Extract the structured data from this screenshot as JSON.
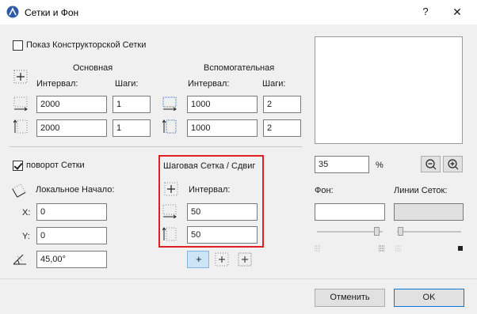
{
  "window": {
    "title": "Сетки и Фон",
    "help": "?",
    "close": "✕"
  },
  "construction_grid": {
    "show_label": "Показ Конструкторской Сетки",
    "main_header": "Основная",
    "aux_header": "Вспомогательная",
    "interval_label": "Интервал:",
    "steps_label": "Шаги:",
    "main_x_interval": "2000",
    "main_x_steps": "1",
    "main_y_interval": "2000",
    "main_y_steps": "1",
    "aux_x_interval": "1000",
    "aux_x_steps": "2",
    "aux_y_interval": "1000",
    "aux_y_steps": "2"
  },
  "rotation": {
    "label": "поворот Сетки",
    "origin_label": "Локальное Начало:",
    "x_label": "X:",
    "x_value": "0",
    "y_label": "Y:",
    "y_value": "0",
    "angle_value": "45,00°"
  },
  "snap_grid": {
    "header": "Шаговая Сетка / Сдвиг",
    "interval_label": "Интервал:",
    "x_value": "50",
    "y_value": "50"
  },
  "preview": {
    "zoom_value": "35",
    "zoom_unit": "%",
    "background_label": "Фон:",
    "grid_lines_label": "Линии Сеток:",
    "background_color": "#ffffff",
    "grid_lines_color": "#e0e0e0"
  },
  "buttons": {
    "cancel": "Отменить",
    "ok": "OK"
  },
  "icons": {
    "app": "archicad-icon",
    "zoom_out": "zoom-out-icon",
    "zoom_in": "zoom-in-icon"
  }
}
